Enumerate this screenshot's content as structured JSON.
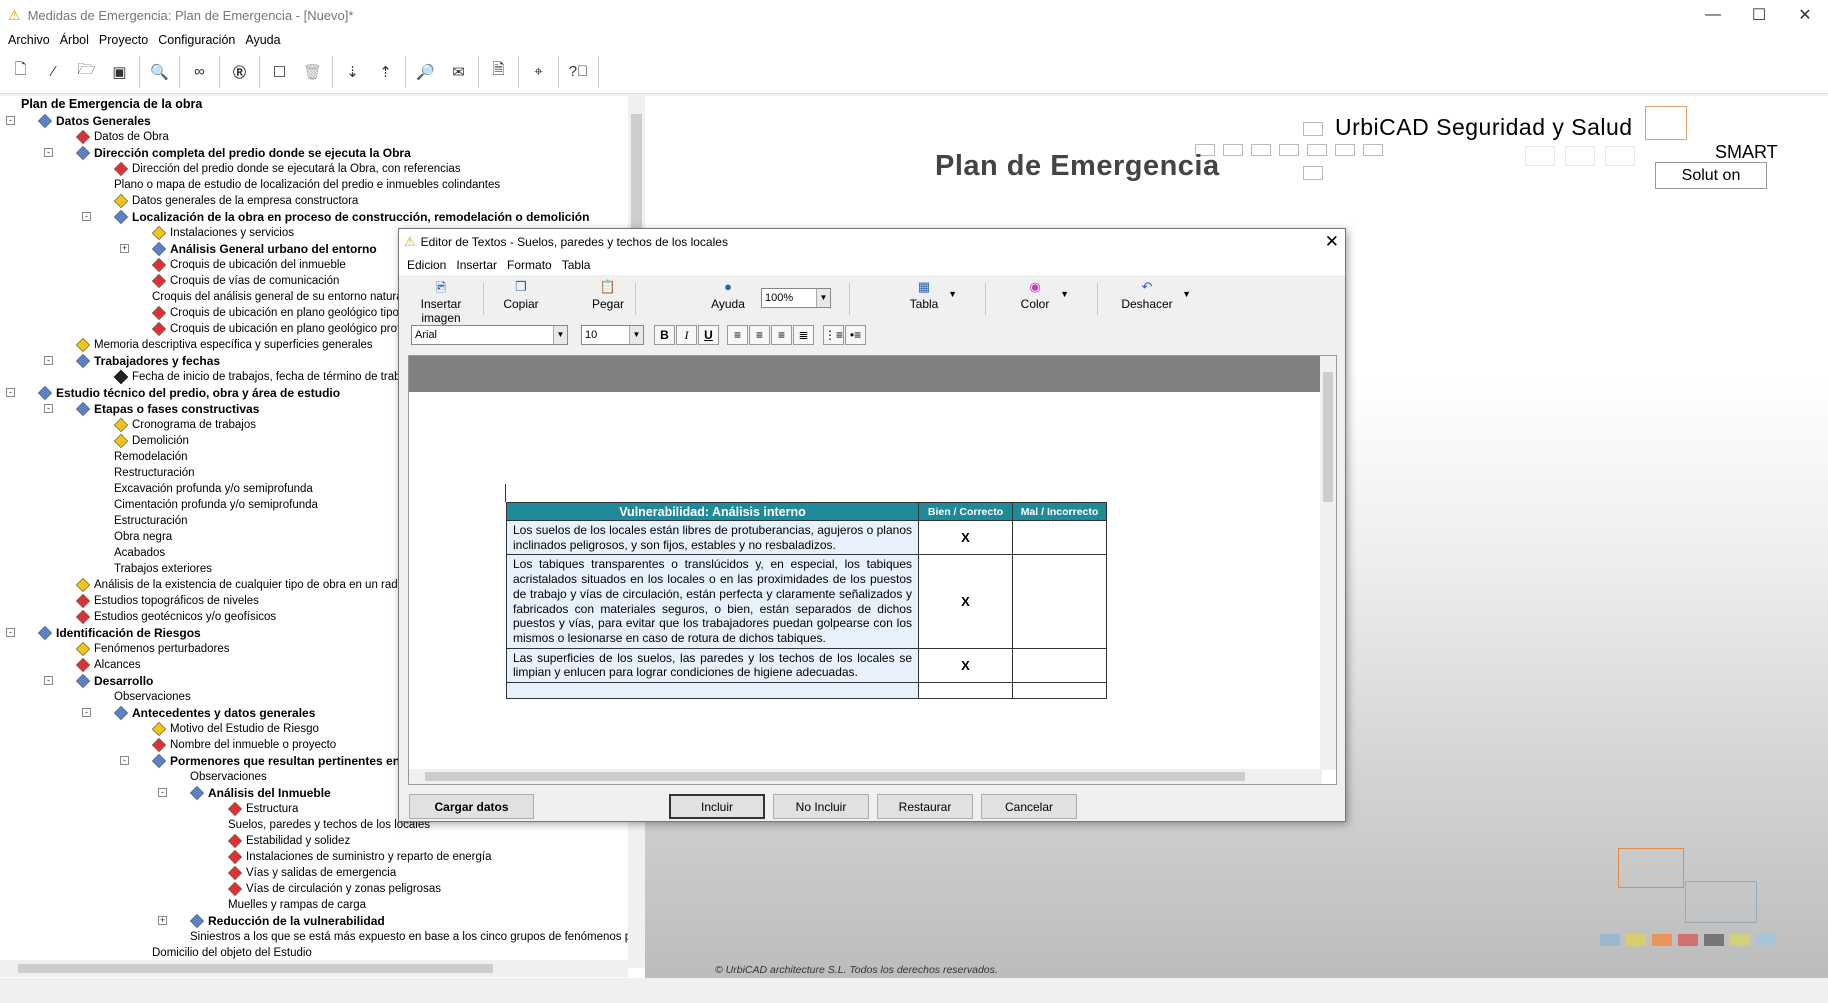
{
  "window": {
    "title": "Medidas de Emergencia: Plan de Emergencia - [Nuevo]*"
  },
  "menu": [
    "Archivo",
    "Árbol",
    "Proyecto",
    "Configuración",
    "Ayuda"
  ],
  "toolbar_icons": [
    "new-document-icon",
    "wand-icon",
    "open-folder-icon",
    "save-icon",
    "preview-icon",
    "binoculars-icon",
    "r-icon",
    "comment-icon",
    "trash-icon",
    "sort-down-icon",
    "sort-up-icon",
    "search-doc-icon",
    "mail-icon",
    "pdf-icon",
    "location-pin-icon",
    "help-icon"
  ],
  "tree": {
    "root": "Plan de Emergencia de la obra",
    "nodes": [
      {
        "label": "Datos Generales",
        "level": 0,
        "bold": true,
        "icon": "folder",
        "toggle": "-"
      },
      {
        "label": "Datos de Obra",
        "level": 1,
        "icon": "red"
      },
      {
        "label": "Dirección completa del predio donde se ejecuta la Obra",
        "level": 1,
        "bold": true,
        "icon": "folder",
        "toggle": "-"
      },
      {
        "label": "Dirección del predio donde se ejecutará la Obra, con referencias",
        "level": 2,
        "icon": "red"
      },
      {
        "label": "Plano o mapa de estudio de localización del predio e inmuebles colindantes",
        "level": 2,
        "icon": "none"
      },
      {
        "label": "Datos generales de la empresa constructora",
        "level": 2,
        "icon": "yellow"
      },
      {
        "label": "Localización de la obra en proceso de construcción, remodelación o demolición",
        "level": 2,
        "bold": true,
        "icon": "folder",
        "toggle": "-"
      },
      {
        "label": "Instalaciones y servicios",
        "level": 3,
        "icon": "yellow"
      },
      {
        "label": "Análisis General  urbano del entorno",
        "level": 3,
        "bold": true,
        "icon": "folder",
        "toggle": "+"
      },
      {
        "label": "Croquis de ubicación del inmueble",
        "level": 3,
        "icon": "red"
      },
      {
        "label": "Croquis de vías de comunicación",
        "level": 3,
        "icon": "red"
      },
      {
        "label": "Croquis del análisis general de su entorno natura",
        "level": 3,
        "icon": "none"
      },
      {
        "label": "Croquis de ubicación  en plano geológico tipo su",
        "level": 3,
        "icon": "red"
      },
      {
        "label": "Croquis de ubicación en plano geológico profun",
        "level": 3,
        "icon": "red"
      },
      {
        "label": "Memoria descriptiva específica y superficies generales",
        "level": 1,
        "icon": "yellow"
      },
      {
        "label": "Trabajadores y fechas",
        "level": 1,
        "bold": true,
        "icon": "folder",
        "toggle": "-"
      },
      {
        "label": "Fecha de inicio de trabajos, fecha de término de trabajos",
        "level": 2,
        "icon": "black"
      },
      {
        "label": "Estudio técnico del predio, obra y área de estudio",
        "level": 0,
        "bold": true,
        "icon": "folder",
        "toggle": "-"
      },
      {
        "label": "Etapas o fases constructivas",
        "level": 1,
        "bold": true,
        "icon": "folder",
        "toggle": "-"
      },
      {
        "label": "Cronograma de trabajos",
        "level": 2,
        "icon": "yellow"
      },
      {
        "label": "Demolición",
        "level": 2,
        "icon": "yellow"
      },
      {
        "label": "Remodelación",
        "level": 2,
        "icon": "none"
      },
      {
        "label": "Restructuración",
        "level": 2,
        "icon": "none"
      },
      {
        "label": "Excavación profunda y/o semiprofunda",
        "level": 2,
        "icon": "none"
      },
      {
        "label": "Cimentación profunda y/o semiprofunda",
        "level": 2,
        "icon": "none"
      },
      {
        "label": "Estructuración",
        "level": 2,
        "icon": "none"
      },
      {
        "label": "Obra negra",
        "level": 2,
        "icon": "none"
      },
      {
        "label": "Acabados",
        "level": 2,
        "icon": "none"
      },
      {
        "label": "Trabajos exteriores",
        "level": 2,
        "icon": "none"
      },
      {
        "label": "Análisis de la existencia de cualquier tipo de obra en un radio de",
        "level": 1,
        "icon": "yellow"
      },
      {
        "label": "Estudios topográficos de niveles",
        "level": 1,
        "icon": "red"
      },
      {
        "label": "Estudios geotécnicos y/o geofísicos",
        "level": 1,
        "icon": "red"
      },
      {
        "label": "Identificación de Riesgos",
        "level": 0,
        "bold": true,
        "icon": "folder",
        "toggle": "-"
      },
      {
        "label": "Fenómenos perturbadores",
        "level": 1,
        "icon": "yellow"
      },
      {
        "label": "Alcances",
        "level": 1,
        "icon": "red"
      },
      {
        "label": "Desarrollo",
        "level": 1,
        "bold": true,
        "icon": "folder",
        "toggle": "-"
      },
      {
        "label": "Observaciones",
        "level": 2,
        "icon": "none"
      },
      {
        "label": "Antecedentes y datos generales",
        "level": 2,
        "bold": true,
        "icon": "folder",
        "toggle": "-"
      },
      {
        "label": "Motivo del Estudio de Riesgo",
        "level": 3,
        "icon": "yellow"
      },
      {
        "label": "Nombre del inmueble o proyecto",
        "level": 3,
        "icon": "red"
      },
      {
        "label": "Pormenores que resultan pertinentes en",
        "level": 3,
        "bold": true,
        "icon": "folder",
        "toggle": "-"
      },
      {
        "label": "Observaciones",
        "level": 4,
        "icon": "none"
      },
      {
        "label": "Análisis del Inmueble",
        "level": 4,
        "bold": true,
        "icon": "folder",
        "toggle": "-"
      },
      {
        "label": "Estructura",
        "level": 5,
        "icon": "red"
      },
      {
        "label": "Suelos, paredes y techos de los locales",
        "level": 5,
        "icon": "none"
      },
      {
        "label": "Estabilidad y solidez",
        "level": 5,
        "icon": "red"
      },
      {
        "label": "Instalaciones de suministro y reparto de energía",
        "level": 5,
        "icon": "red"
      },
      {
        "label": "Vías y salidas de emergencia",
        "level": 5,
        "icon": "red"
      },
      {
        "label": "Vías de circulación y zonas peligrosas",
        "level": 5,
        "icon": "red"
      },
      {
        "label": "Muelles y rampas de carga",
        "level": 5,
        "icon": "none"
      },
      {
        "label": "Reducción de la vulnerabilidad",
        "level": 4,
        "bold": true,
        "icon": "folder",
        "toggle": "+"
      },
      {
        "label": "Siniestros a los que se está más expuesto en base a los cinco grupos de fenómenos per",
        "level": 4,
        "icon": "none"
      },
      {
        "label": "Domicilio del objeto del Estudio",
        "level": 3,
        "icon": "none"
      }
    ]
  },
  "brand": {
    "name": "UrbiCAD Seguridad y Salud",
    "plan_title": "Plan de Emergencia",
    "smart": "SMART",
    "solution": "Solut on",
    "copyright": "©  UrbiCAD architecture S.L. Todos los derechos reservados."
  },
  "dialog": {
    "title": "Editor de Textos - Suelos, paredes y techos de los locales",
    "menu": [
      "Edicion",
      "Insertar",
      "Formato",
      "Tabla"
    ],
    "tools": {
      "insert_image": "Insertar imagen",
      "copy": "Copiar",
      "paste": "Pegar",
      "help": "Ayuda",
      "zoom": "100%",
      "table": "Tabla",
      "color": "Color",
      "undo": "Deshacer"
    },
    "font": "Arial",
    "size": "10",
    "format_buttons": {
      "bold": "B",
      "italic": "I",
      "underline": "U"
    },
    "table": {
      "headers": [
        "Vulnerabilidad: Análisis interno",
        "Bien / Correcto",
        "Mal / Incorrecto"
      ],
      "rows": [
        {
          "text": "Los suelos de los locales están libres de protuberancias, agujeros o planos inclinados peligrosos, y son fijos, estables y no resbaladizos.",
          "bien": "X",
          "mal": ""
        },
        {
          "text": "Los tabiques transparentes o translúcidos y, en especial, los tabiques acristalados situados en los locales o en las proximidades de los puestos de trabajo y vías de circulación, están perfecta y claramente señalizados y fabricados con materiales seguros, o bien, están separados de dichos puestos y vías, para evitar que los trabajadores puedan golpearse con los mismos o lesionarse en caso de rotura de dichos tabiques.",
          "bien": "X",
          "mal": ""
        },
        {
          "text": "Las superficies de los suelos, las paredes y los techos de los locales se limpian y enlucen para lograr condiciones de higiene adecuadas.",
          "bien": "X",
          "mal": ""
        }
      ]
    },
    "buttons": {
      "load": "Cargar datos",
      "include": "Incluir",
      "exclude": "No Incluir",
      "restore": "Restaurar",
      "cancel": "Cancelar"
    }
  }
}
